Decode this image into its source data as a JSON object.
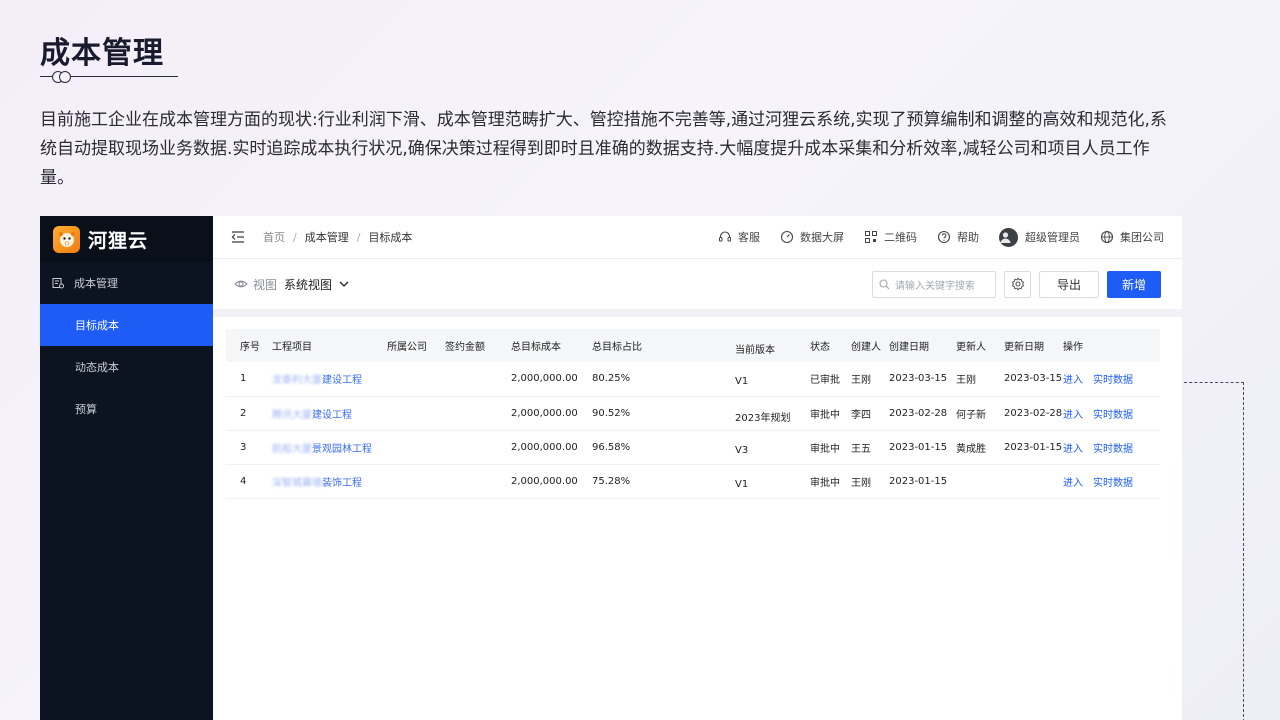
{
  "slide": {
    "title": "成本管理",
    "description": "目前施工企业在成本管理方面的现状:行业利润下滑、成本管理范畴扩大、管控措施不完善等,通过河狸云系统,实现了预算编制和调整的高效和规范化,系统自动提取现场业务数据.实时追踪成本执行状况,确保决策过程得到即时且准确的数据支持.大幅度提升成本采集和分析效率,减轻公司和项目人员工作量。"
  },
  "app": {
    "brand": "河狸云",
    "sidebar": {
      "group": "成本管理",
      "items": [
        {
          "label": "目标成本",
          "active": true
        },
        {
          "label": "动态成本",
          "active": false
        },
        {
          "label": "预算",
          "active": false
        }
      ]
    },
    "breadcrumb": [
      "首页",
      "成本管理",
      "目标成本"
    ],
    "tools": {
      "service": "客服",
      "dashboard": "数据大屏",
      "qrcode": "二维码",
      "help": "帮助",
      "user": "超级管理员",
      "company": "集团公司"
    },
    "toolbar": {
      "view_label": "视图",
      "view_value": "系统视图",
      "search_placeholder": "请输入关键字搜索",
      "export": "导出",
      "add": "新增"
    },
    "table": {
      "headers": [
        "序号",
        "工程项目",
        "所属公司",
        "签约金额",
        "总目标成本",
        "总目标占比",
        "当前版本",
        "状态",
        "创建人",
        "创建日期",
        "更新人",
        "更新日期",
        "操作"
      ],
      "rows": [
        {
          "no": "1",
          "proj_a": "龙泰利大厦",
          "proj_b": "建设工程",
          "company": "",
          "amount": "",
          "cost": "2,000,000.00",
          "ratio": "80.25%",
          "version": "V1",
          "status": "已审批",
          "creator": "王刚",
          "created": "2023-03-15",
          "updater": "王刚",
          "updated": "2023-03-15",
          "op1": "进入",
          "op2": "实时数据"
        },
        {
          "no": "2",
          "proj_a": "腾讯大厦",
          "proj_b": "建设工程",
          "company": "",
          "amount": "",
          "cost": "2,000,000.00",
          "ratio": "90.52%",
          "version": "2023年规划",
          "status": "审批中",
          "creator": "李四",
          "created": "2023-02-28",
          "updater": "何子新",
          "updated": "2023-02-28",
          "op1": "进入",
          "op2": "实时数据"
        },
        {
          "no": "3",
          "proj_a": "航船大厦",
          "proj_b": "景观园林工程",
          "company": "",
          "amount": "",
          "cost": "2,000,000.00",
          "ratio": "96.58%",
          "version": "V3",
          "status": "审批中",
          "creator": "王五",
          "created": "2023-01-15",
          "updater": "黄成胜",
          "updated": "2023-01-15",
          "op1": "进入",
          "op2": "实时数据"
        },
        {
          "no": "4",
          "proj_a": "深智城幕墙",
          "proj_b": "装饰工程",
          "company": "",
          "amount": "",
          "cost": "2,000,000.00",
          "ratio": "75.28%",
          "version": "V1",
          "status": "审批中",
          "creator": "王刚",
          "created": "2023-01-15",
          "updater": "",
          "updated": "",
          "op1": "进入",
          "op2": "实时数据"
        }
      ]
    },
    "colors": {
      "primary": "#1e5cf6",
      "sidebar": "#0d1421"
    }
  }
}
